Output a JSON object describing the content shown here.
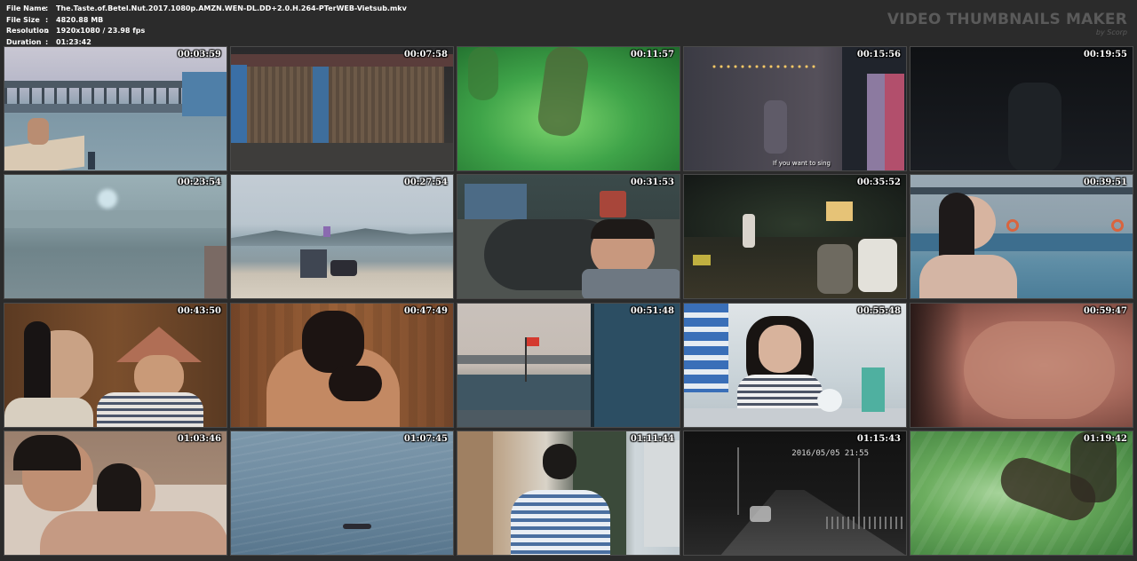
{
  "info": [
    {
      "key": "File Name",
      "value": "The.Taste.of.Betel.Nut.2017.1080p.AMZN.WEN-DL.DD+2.0.H.264-PTerWEB-Vietsub.mkv"
    },
    {
      "key": "File Size",
      "value": "4820.88 MB"
    },
    {
      "key": "Resolution",
      "value": "1920x1080 / 23.98 fps"
    },
    {
      "key": "Duration",
      "value": "01:23:42"
    }
  ],
  "info_separator": ":",
  "brand": {
    "title": "VIDEO THUMBNAILS MAKER",
    "subtitle": "by Scorp"
  },
  "thumbnails": [
    {
      "time": "00:03:59",
      "scene": "pier-dock-man-crouching"
    },
    {
      "time": "00:07:58",
      "scene": "closed-shop-shutter"
    },
    {
      "time": "00:11:57",
      "scene": "underwater-green-legs"
    },
    {
      "time": "00:15:56",
      "scene": "night-street-crowd",
      "subtitle": "If you want to sing"
    },
    {
      "time": "00:19:55",
      "scene": "dark-night-scene"
    },
    {
      "time": "00:23:54",
      "scene": "blurred-sea-closeup"
    },
    {
      "time": "00:27:54",
      "scene": "beach-with-vehicle"
    },
    {
      "time": "00:31:53",
      "scene": "man-lying-on-pillow"
    },
    {
      "time": "00:35:52",
      "scene": "night-outdoor-dinner"
    },
    {
      "time": "00:39:51",
      "scene": "girl-at-harbor"
    },
    {
      "time": "00:43:50",
      "scene": "couple-wooden-room"
    },
    {
      "time": "00:47:49",
      "scene": "intimate-wooden-room"
    },
    {
      "time": "00:51:48",
      "scene": "harbor-fishing-boats"
    },
    {
      "time": "00:55:48",
      "scene": "girl-at-table-cafe"
    },
    {
      "time": "00:59:47",
      "scene": "skin-closeup"
    },
    {
      "time": "01:03:46",
      "scene": "couple-sleeping"
    },
    {
      "time": "01:07:45",
      "scene": "person-floating-sea"
    },
    {
      "time": "01:11:44",
      "scene": "man-walking-alley"
    },
    {
      "time": "01:15:43",
      "scene": "cctv-night-bridge",
      "overlay": "2016/05/05   21:55"
    },
    {
      "time": "01:19:42",
      "scene": "underwater-green-foot"
    }
  ]
}
